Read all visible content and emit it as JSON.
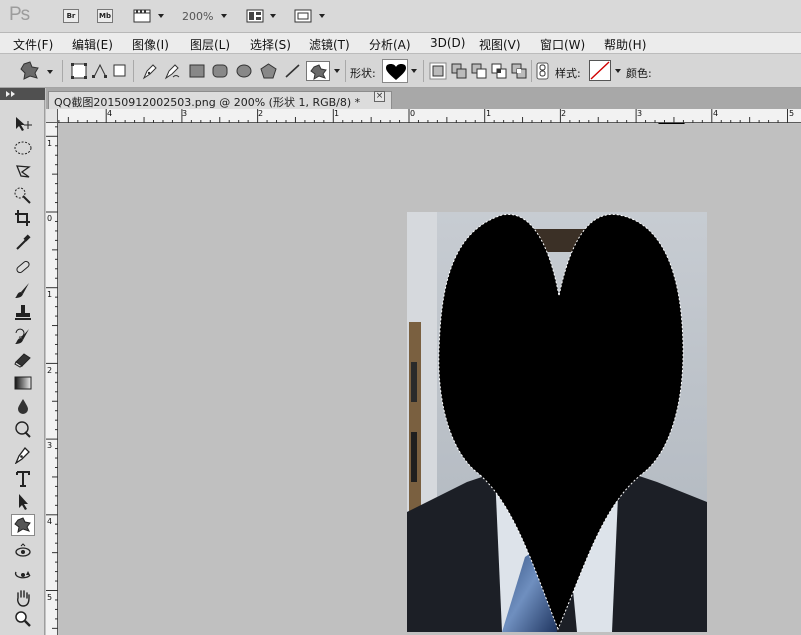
{
  "app": {
    "logo": "Ps",
    "bridge_label": "Br",
    "minibridge_label": "Mb",
    "zoom": "200%"
  },
  "menu": [
    "文件(F)",
    "编辑(E)",
    "图像(I)",
    "图层(L)",
    "选择(S)",
    "滤镜(T)",
    "分析(A)",
    "3D(D)",
    "视图(V)",
    "窗口(W)",
    "帮助(H)"
  ],
  "options": {
    "shape_label": "形状:",
    "style_label": "样式:",
    "color_label": "颜色:",
    "color_value": "#000000",
    "selected_shape": "heart-shape"
  },
  "document": {
    "tab_title": "QQ截图20150912002503.png @ 200% (形状 1, RGB/8) *",
    "close_glyph": "×"
  },
  "ruler": {
    "h": [
      "4",
      "3",
      "2",
      "1",
      "0",
      "1",
      "2",
      "3",
      "4",
      "5"
    ],
    "v": [
      "1",
      "0",
      "1",
      "2",
      "3",
      "4",
      "5"
    ]
  },
  "tools": [
    "move-tool",
    "elliptical-marquee-tool",
    "lasso-tool",
    "quick-selection-tool",
    "crop-tool",
    "eyedropper-tool",
    "spot-healing-tool",
    "brush-tool",
    "clone-stamp-tool",
    "history-brush-tool",
    "eraser-tool",
    "gradient-tool",
    "blur-tool",
    "dodge-tool",
    "pen-tool",
    "type-tool",
    "path-selection-tool",
    "custom-shape-tool",
    "3d-rotate-tool",
    "3d-orbit-tool",
    "hand-tool",
    "zoom-tool"
  ]
}
